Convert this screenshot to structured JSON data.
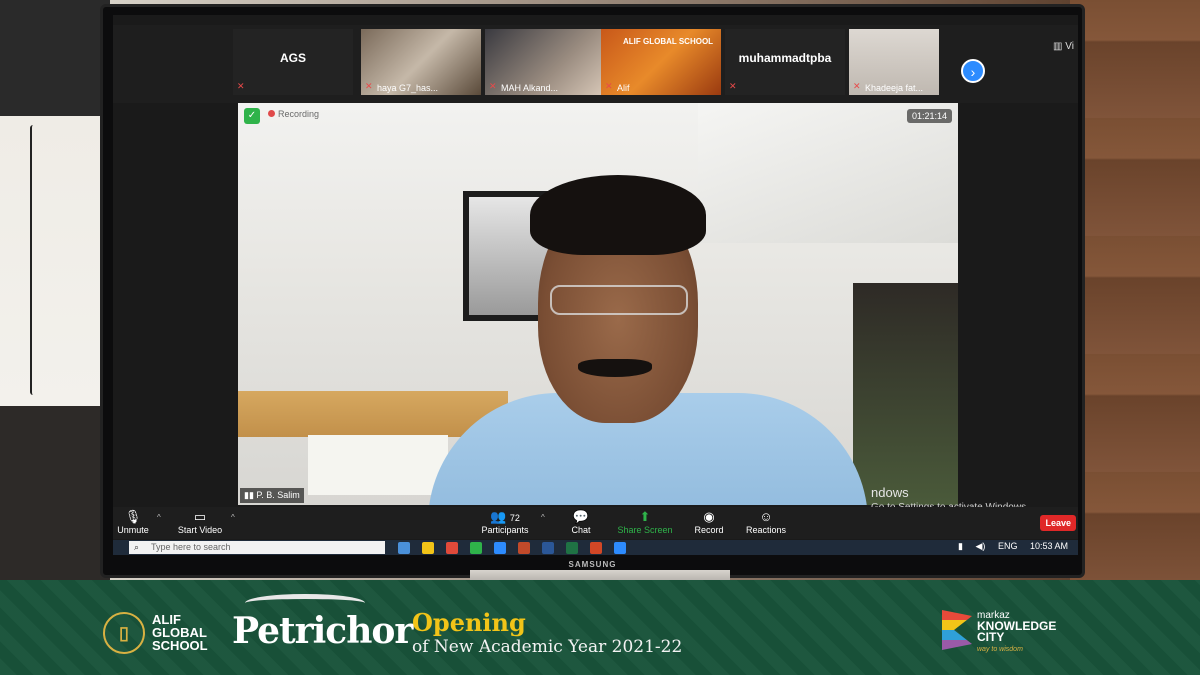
{
  "zoom": {
    "participants": [
      {
        "name": "AGS",
        "label": ""
      },
      {
        "name": "",
        "label": "haya G7_has..."
      },
      {
        "name": "",
        "label": "MAH Alkand..."
      },
      {
        "name": "",
        "label": "Alif"
      },
      {
        "name": "muhammadtpba",
        "label": ""
      },
      {
        "name": "",
        "label": "Khadeeja fat..."
      }
    ],
    "alif_tile_brand": "ALIF GLOBAL SCHOOL",
    "view_label": "Vi",
    "recording_label": "Recording",
    "timer": "01:21:14",
    "speaker_name": "P. B. Salim",
    "toolbar": {
      "unmute": "Unmute",
      "start_video": "Start Video",
      "participants": "Participants",
      "participants_count": "72",
      "chat": "Chat",
      "share_screen": "Share Screen",
      "record": "Record",
      "reactions": "Reactions",
      "leave": "Leave"
    },
    "activate_windows": {
      "title": "ndows",
      "subtitle": "Go to Settings to activate Windows."
    }
  },
  "taskbar": {
    "search_placeholder": "Type here to search",
    "language": "ENG",
    "time": "10:53 AM",
    "app_colors": [
      "#4a90d9",
      "#f2c418",
      "#e04a3a",
      "#2fb34a",
      "#2d8cff",
      "#c14a2a",
      "#2b5797",
      "#1f7244",
      "#d24726",
      "#2d8cff"
    ]
  },
  "monitor_brand": "SAMSUNG",
  "banner": {
    "school_line1": "ALIF",
    "school_line2": "GLOBAL",
    "school_line3": "SCHOOL",
    "event": "Petrichor",
    "opening": "Opening",
    "subtitle": "of New Academic Year 2021-22",
    "partner_line1": "markaz",
    "partner_line2": "KNOWLEDGE",
    "partner_line3": "CITY",
    "partner_tagline": "way to wisdom"
  }
}
